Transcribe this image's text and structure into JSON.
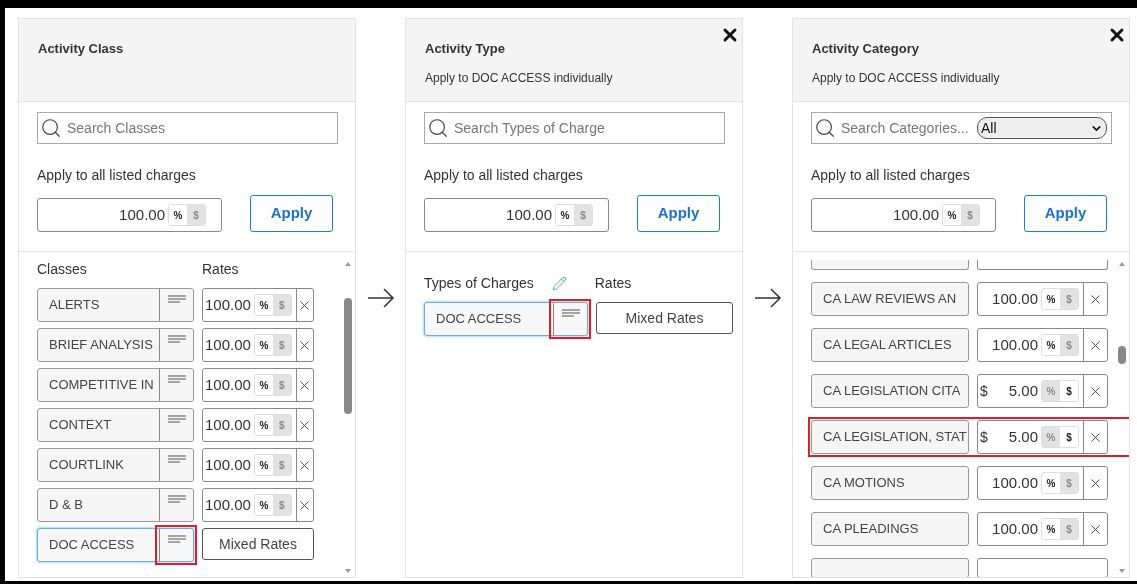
{
  "panels": [
    {
      "title": "Activity Class",
      "close": false,
      "search": {
        "placeholder": "Search Classes"
      },
      "apply_label": "Apply to all listed charges",
      "apply_value": {
        "value": "100.00",
        "units": [
          {
            "label": "%",
            "selected": true
          },
          {
            "label": "$",
            "selected": false
          }
        ]
      },
      "apply_button": "Apply",
      "list": {
        "columns": [
          "Classes",
          "Rates"
        ],
        "edit_icon": false,
        "rows": [
          {
            "name": "ALERTS",
            "menu": true,
            "selected": false,
            "highlighted": false,
            "rate": {
              "kind": "amount",
              "value": "100.00",
              "units": [
                {
                  "label": "%",
                  "selected": true
                },
                {
                  "label": "$",
                  "selected": false
                }
              ]
            }
          },
          {
            "name": "BRIEF ANALYSIS",
            "menu": true,
            "selected": false,
            "highlighted": false,
            "rate": {
              "kind": "amount",
              "value": "100.00",
              "units": [
                {
                  "label": "%",
                  "selected": true
                },
                {
                  "label": "$",
                  "selected": false
                }
              ]
            }
          },
          {
            "name": "COMPETITIVE IN",
            "menu": true,
            "selected": false,
            "highlighted": false,
            "rate": {
              "kind": "amount",
              "value": "100.00",
              "units": [
                {
                  "label": "%",
                  "selected": true
                },
                {
                  "label": "$",
                  "selected": false
                }
              ]
            }
          },
          {
            "name": "CONTEXT",
            "menu": true,
            "selected": false,
            "highlighted": false,
            "rate": {
              "kind": "amount",
              "value": "100.00",
              "units": [
                {
                  "label": "%",
                  "selected": true
                },
                {
                  "label": "$",
                  "selected": false
                }
              ]
            }
          },
          {
            "name": "COURTLINK",
            "menu": true,
            "selected": false,
            "highlighted": false,
            "rate": {
              "kind": "amount",
              "value": "100.00",
              "units": [
                {
                  "label": "%",
                  "selected": true
                },
                {
                  "label": "$",
                  "selected": false
                }
              ]
            }
          },
          {
            "name": "D & B",
            "menu": true,
            "selected": false,
            "highlighted": false,
            "rate": {
              "kind": "amount",
              "value": "100.00",
              "units": [
                {
                  "label": "%",
                  "selected": true
                },
                {
                  "label": "$",
                  "selected": false
                }
              ]
            }
          },
          {
            "name": "DOC ACCESS",
            "menu": true,
            "selected": true,
            "highlighted": true,
            "rate": {
              "kind": "mixed",
              "label": "Mixed Rates"
            }
          }
        ]
      }
    },
    {
      "title": "Activity Type",
      "subtitle": "Apply to DOC ACCESS individually",
      "close": true,
      "search": {
        "placeholder": "Search Types of Charge"
      },
      "apply_label": "Apply to all listed charges",
      "apply_value": {
        "value": "100.00",
        "units": [
          {
            "label": "%",
            "selected": true
          },
          {
            "label": "$",
            "selected": false
          }
        ]
      },
      "apply_button": "Apply",
      "list": {
        "columns": [
          "Types of Charges",
          "Rates"
        ],
        "edit_icon": true,
        "rows": [
          {
            "name": "DOC ACCESS",
            "menu": true,
            "selected": true,
            "highlighted": true,
            "rate": {
              "kind": "mixed",
              "label": "Mixed Rates"
            }
          }
        ]
      }
    },
    {
      "title": "Activity Category",
      "subtitle": "Apply to DOC ACCESS individually",
      "close": true,
      "search": {
        "placeholder": "Search Categories...",
        "filter": "All"
      },
      "apply_label": "Apply to all listed charges",
      "apply_value": {
        "value": "100.00",
        "units": [
          {
            "label": "%",
            "selected": true
          },
          {
            "label": "$",
            "selected": false
          }
        ]
      },
      "apply_button": "Apply",
      "list": {
        "edit_icon": false,
        "rows": [
          {
            "name": "CA LAW REVIEWS AN",
            "menu": false,
            "selected": false,
            "highlighted": false,
            "rate": {
              "kind": "amount",
              "value": "100.00",
              "units": [
                {
                  "label": "%",
                  "selected": true
                },
                {
                  "label": "$",
                  "selected": false
                }
              ]
            }
          },
          {
            "name": "CA LEGAL ARTICLES",
            "menu": false,
            "selected": false,
            "highlighted": false,
            "rate": {
              "kind": "amount",
              "value": "100.00",
              "units": [
                {
                  "label": "%",
                  "selected": true
                },
                {
                  "label": "$",
                  "selected": false
                }
              ]
            }
          },
          {
            "name": "CA LEGISLATION CITA",
            "menu": false,
            "selected": false,
            "highlighted": false,
            "rate": {
              "kind": "amount",
              "prefix": "$",
              "value": "5.00",
              "units": [
                {
                  "label": "%",
                  "selected": false
                },
                {
                  "label": "$",
                  "selected": true
                }
              ]
            }
          },
          {
            "name": "CA LEGISLATION, STAT",
            "menu": false,
            "selected": false,
            "highlighted": true,
            "rate": {
              "kind": "amount",
              "prefix": "$",
              "value": "5.00",
              "units": [
                {
                  "label": "%",
                  "selected": false
                },
                {
                  "label": "$",
                  "selected": true
                }
              ]
            }
          },
          {
            "name": "CA MOTIONS",
            "menu": false,
            "selected": false,
            "highlighted": false,
            "rate": {
              "kind": "amount",
              "value": "100.00",
              "units": [
                {
                  "label": "%",
                  "selected": true
                },
                {
                  "label": "$",
                  "selected": false
                }
              ]
            }
          },
          {
            "name": "CA PLEADINGS",
            "menu": false,
            "selected": false,
            "highlighted": false,
            "rate": {
              "kind": "amount",
              "value": "100.00",
              "units": [
                {
                  "label": "%",
                  "selected": true
                },
                {
                  "label": "$",
                  "selected": false
                }
              ]
            }
          }
        ]
      }
    }
  ]
}
